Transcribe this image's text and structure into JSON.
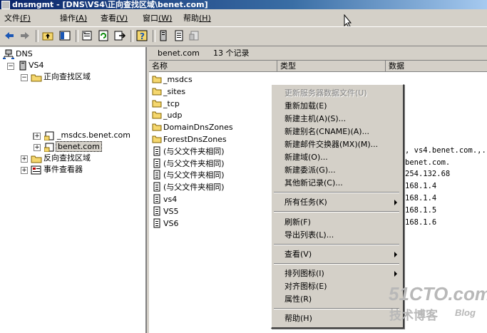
{
  "window": {
    "title": "dnsmgmt - [DNS\\VS4\\正向查找区域\\benet.com]"
  },
  "menu": [
    {
      "label": "文件",
      "key": "(F)"
    },
    {
      "label": "操作",
      "key": "(A)"
    },
    {
      "label": "查看",
      "key": "(V)"
    },
    {
      "label": "窗口",
      "key": "(W)"
    },
    {
      "label": "帮助",
      "key": "(H)"
    }
  ],
  "toolbar": {
    "icons": [
      "back-icon",
      "forward-icon",
      "up-folder-icon",
      "show-hide-tree-icon",
      "properties-icon",
      "refresh-icon",
      "export-icon",
      "help-icon",
      "server-icon",
      "document-icon",
      "print-icon"
    ]
  },
  "tree": {
    "root": "DNS",
    "server": "VS4",
    "forward_zones": "正向查找区域",
    "zone1": "_msdcs.benet.com",
    "zone2": "benet.com",
    "reverse_zones": "反向查找区域",
    "event_viewer": "事件查看器"
  },
  "list": {
    "zone": "benet.com",
    "count": "13 个记录",
    "columns": [
      "名称",
      "类型",
      "数据"
    ],
    "rows": [
      {
        "name": "_msdcs",
        "icon": "folder-icon",
        "data": ""
      },
      {
        "name": "_sites",
        "icon": "folder-icon",
        "data": ""
      },
      {
        "name": "_tcp",
        "icon": "folder-icon",
        "data": ""
      },
      {
        "name": "_udp",
        "icon": "folder-icon",
        "data": ""
      },
      {
        "name": "DomainDnsZones",
        "icon": "folder-icon",
        "data": ""
      },
      {
        "name": "ForestDnsZones",
        "icon": "folder-icon",
        "data": ""
      },
      {
        "name": "(与父文件夹相同)",
        "icon": "record-icon",
        "data": ", vs4.benet.com.,..."
      },
      {
        "name": "(与父文件夹相同)",
        "icon": "record-icon",
        "data": "benet.com."
      },
      {
        "name": "(与父文件夹相同)",
        "icon": "record-icon",
        "data": "254.132.68"
      },
      {
        "name": "(与父文件夹相同)",
        "icon": "record-icon",
        "data": "168.1.4"
      },
      {
        "name": "vs4",
        "icon": "record-icon",
        "data": "168.1.4"
      },
      {
        "name": "VS5",
        "icon": "record-icon",
        "data": "168.1.5"
      },
      {
        "name": "VS6",
        "icon": "record-icon",
        "data": "168.1.6"
      }
    ]
  },
  "context_menu": {
    "update_server_file": "更新服务器数据文件(U)",
    "reload": "重新加载(E)",
    "new_host": "新建主机(A)(S)...",
    "new_alias": "新建别名(CNAME)(A)...",
    "new_mx": "新建邮件交换器(MX)(M)...",
    "new_domain": "新建域(O)...",
    "new_delegation": "新建委派(G)...",
    "other_records": "其他新记录(C)...",
    "all_tasks": "所有任务(K)",
    "refresh": "刷新(F)",
    "export_list": "导出列表(L)...",
    "view": "查看(V)",
    "arrange_icons": "排列图标(I)",
    "line_up_icons": "对齐图标(E)",
    "properties": "属性(R)",
    "help": "帮助(H)"
  },
  "watermark": {
    "site": "51CTO.com",
    "sub": "技术博客",
    "blog": "Blog"
  },
  "colors": {
    "title_start": "#0a246a",
    "title_end": "#a6caf0",
    "face": "#d4d0c8",
    "folder": "#f5d76e"
  }
}
